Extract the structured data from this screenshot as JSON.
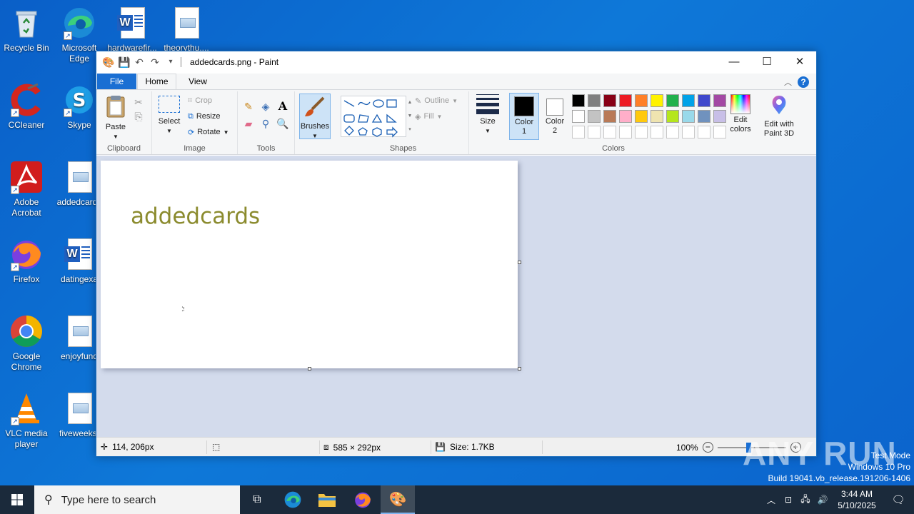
{
  "desktop": {
    "icons": [
      {
        "label": "Recycle Bin"
      },
      {
        "label": "Microsoft Edge"
      },
      {
        "label": "hardwarefir..."
      },
      {
        "label": "theorythu...."
      },
      {
        "label": "CCleaner"
      },
      {
        "label": "Skype"
      },
      {
        "label": "Adobe Acrobat"
      },
      {
        "label": "addedcards"
      },
      {
        "label": "Firefox"
      },
      {
        "label": "datingexa"
      },
      {
        "label": "Google Chrome"
      },
      {
        "label": "enjoyfund"
      },
      {
        "label": "VLC media player"
      },
      {
        "label": "fiveweeks."
      }
    ]
  },
  "paint": {
    "title": "addedcards.png - Paint",
    "tabs": {
      "file": "File",
      "home": "Home",
      "view": "View"
    },
    "clipboard": {
      "paste": "Paste",
      "label": "Clipboard"
    },
    "image": {
      "select": "Select",
      "crop": "Crop",
      "resize": "Resize",
      "rotate": "Rotate",
      "label": "Image"
    },
    "tools": {
      "label": "Tools"
    },
    "brushes": {
      "label": "Brushes"
    },
    "shapes": {
      "outline": "Outline",
      "fill": "Fill",
      "label": "Shapes"
    },
    "size": {
      "label": "Size"
    },
    "colors": {
      "color1": "Color 1",
      "color2": "Color 2",
      "edit_colors": "Edit colors",
      "edit_paint3d": "Edit with Paint 3D",
      "label": "Colors",
      "color1_value": "#000000",
      "color2_value": "#ffffff",
      "palette_row1": [
        "#000000",
        "#7f7f7f",
        "#880015",
        "#ed1c24",
        "#ff7f27",
        "#fff200",
        "#22b14c",
        "#00a2e8",
        "#3f48cc",
        "#a349a4"
      ],
      "palette_row2": [
        "#ffffff",
        "#c3c3c3",
        "#b97a57",
        "#ffaec9",
        "#ffc90e",
        "#efe4b0",
        "#b5e61d",
        "#99d9ea",
        "#7092be",
        "#c8bfe7"
      ]
    },
    "canvas_text": "addedcards",
    "status": {
      "cursor": "114, 206px",
      "dimensions": "585 × 292px",
      "size": "Size: 1.7KB",
      "zoom": "100%"
    }
  },
  "watermark": {
    "text": "ANY RUN"
  },
  "system": {
    "test_mode": "Test Mode",
    "edition": "Windows 10 Pro",
    "build": "Build 19041.vb_release.191206-1406"
  },
  "taskbar": {
    "search_placeholder": "Type here to search",
    "time": "3:44 AM",
    "date": "5/10/2025"
  }
}
